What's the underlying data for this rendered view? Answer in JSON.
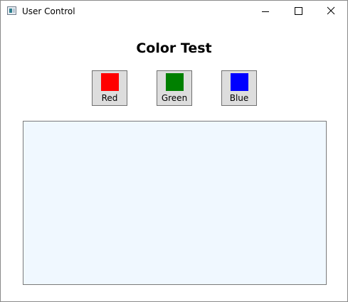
{
  "window": {
    "title": "User Control"
  },
  "main": {
    "heading": "Color Test",
    "buttons": [
      {
        "label": "Red",
        "color": "#ff0000"
      },
      {
        "label": "Green",
        "color": "#008000"
      },
      {
        "label": "Blue",
        "color": "#0000ff"
      }
    ],
    "panel_background": "#f0f8ff"
  },
  "icons": {
    "app": "app-window-icon",
    "minimize": "minimize-icon",
    "maximize": "maximize-icon",
    "close": "close-icon"
  }
}
